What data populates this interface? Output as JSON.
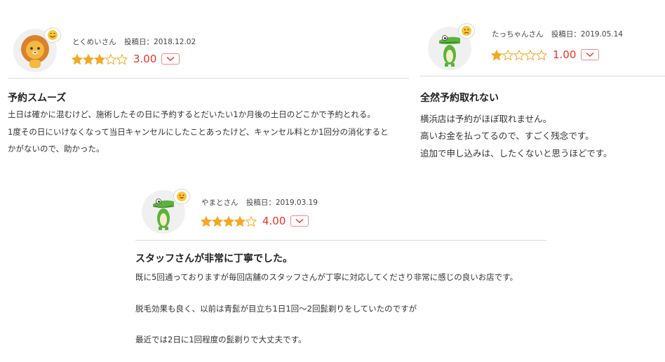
{
  "reviews": [
    {
      "username": "とくめいさん",
      "date_label": "投稿日：2018.12.02",
      "rating": 3,
      "score": "3.00",
      "avatar_icon": "lion-icon",
      "mood_icon": "smile-face-icon",
      "title": "予約スムーズ",
      "body": [
        "土日は確かに混むけど、施術したその日に予約するとだいたい1か月後の土日のどこかで予約とれる。",
        "1度その日にいけなくなって当日キャンセルにしたことあったけど、キャンセル料とか1回分の消化すると",
        "かがないので、助かった。"
      ]
    },
    {
      "username": "たっちゃんさん",
      "date_label": "投稿日：2019.05.14",
      "rating": 1,
      "score": "1.00",
      "avatar_icon": "crocodile-icon",
      "mood_icon": "sad-face-icon",
      "title": "全然予約取れない",
      "body": [
        "横浜店は予約がほぼ取れません。",
        "高いお金を払ってるので、すごく残念です。",
        "追加で申し込みは、したくないと思うほどです。"
      ]
    },
    {
      "username": "やまとさん",
      "date_label": "投稿日：2019.03.19",
      "rating": 4,
      "score": "4.00",
      "avatar_icon": "crocodile-icon",
      "mood_icon": "happy-face-icon",
      "title": "スタッフさんが非常に丁寧でした。",
      "body": [
        "既に5回通っておりますが毎回店舗のスタッフさんが丁寧に対応してくださり非常に感じの良いお店です。",
        "脱毛効果も良く、以前は青髭が目立ち1日1回〜2回髭剃りをしていたのですが",
        "最近では2日に1回程度の髭剃りで大丈夫です。"
      ]
    }
  ],
  "colors": {
    "star": "#f5a623",
    "score": "#e8322b",
    "toggle_border": "#f08a8a",
    "divider": "#dcdcdc",
    "mood_yellow": "#f9c73a"
  }
}
